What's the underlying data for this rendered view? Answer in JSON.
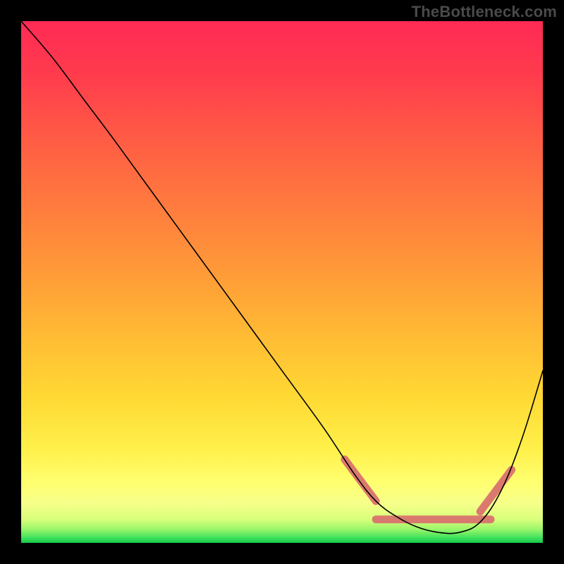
{
  "watermark": "TheBottleneck.com",
  "chart_data": {
    "type": "line",
    "title": "",
    "xlabel": "",
    "ylabel": "",
    "xlim": [
      0,
      100
    ],
    "ylim": [
      0,
      100
    ],
    "grid": false,
    "legend": false,
    "series": [
      {
        "name": "curve",
        "color": "#000000",
        "x": [
          0,
          6,
          12,
          18,
          26,
          34,
          42,
          50,
          58,
          64,
          68,
          72,
          76,
          80,
          84,
          88,
          92,
          96,
          100
        ],
        "y": [
          100,
          93,
          85,
          77,
          66,
          55,
          44,
          33,
          22,
          13,
          8,
          5,
          3,
          2,
          2,
          4,
          10,
          20,
          33
        ]
      }
    ],
    "highlight": {
      "color": "#d9726e",
      "segments": [
        {
          "x": [
            62,
            68
          ],
          "y": [
            16,
            8
          ]
        },
        {
          "x": [
            68,
            90
          ],
          "y": [
            4.5,
            4.5
          ]
        },
        {
          "x": [
            88,
            94
          ],
          "y": [
            6,
            14
          ]
        }
      ]
    },
    "gradient_stops": [
      {
        "offset": 0.0,
        "color": "#ff2a55"
      },
      {
        "offset": 0.1,
        "color": "#ff3b4d"
      },
      {
        "offset": 0.22,
        "color": "#ff5a45"
      },
      {
        "offset": 0.35,
        "color": "#ff7a3e"
      },
      {
        "offset": 0.48,
        "color": "#ff9a38"
      },
      {
        "offset": 0.6,
        "color": "#ffba34"
      },
      {
        "offset": 0.72,
        "color": "#ffd934"
      },
      {
        "offset": 0.82,
        "color": "#fff04a"
      },
      {
        "offset": 0.885,
        "color": "#ffff70"
      },
      {
        "offset": 0.925,
        "color": "#f6ff8a"
      },
      {
        "offset": 0.955,
        "color": "#d9ff7a"
      },
      {
        "offset": 0.975,
        "color": "#96f56a"
      },
      {
        "offset": 0.99,
        "color": "#3fe25e"
      },
      {
        "offset": 1.0,
        "color": "#18c94a"
      }
    ]
  }
}
